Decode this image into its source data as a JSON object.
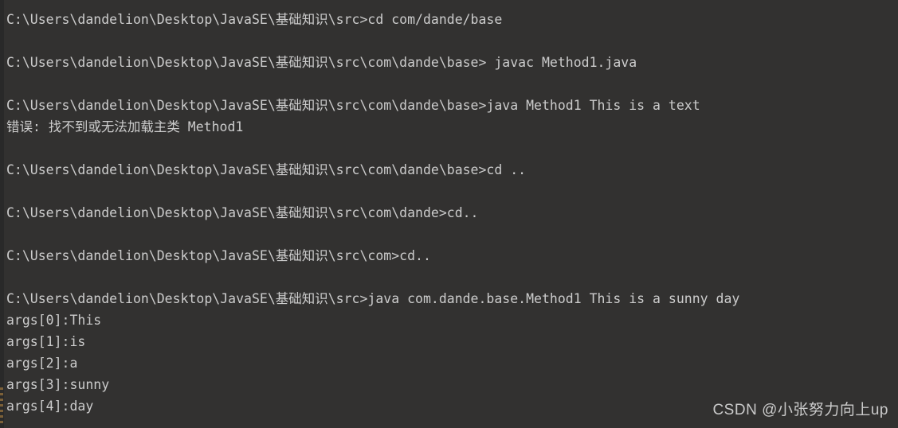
{
  "terminal": {
    "title": "Command Prompt",
    "background_color": "#323130",
    "text_color": "#cccccc",
    "gutter_color": "#292929",
    "lines": [
      {
        "id": "line-0",
        "text": "C:\\Users\\dandelion\\Desktop\\JavaSE\\基础知识\\src>cd com/dande/base"
      },
      {
        "id": "line-1",
        "text": ""
      },
      {
        "id": "line-2",
        "text": "C:\\Users\\dandelion\\Desktop\\JavaSE\\基础知识\\src\\com\\dande\\base> javac Method1.java"
      },
      {
        "id": "line-3",
        "text": ""
      },
      {
        "id": "line-4",
        "text": "C:\\Users\\dandelion\\Desktop\\JavaSE\\基础知识\\src\\com\\dande\\base>java Method1 This is a text"
      },
      {
        "id": "line-5",
        "text": "错误: 找不到或无法加载主类 Method1"
      },
      {
        "id": "line-6",
        "text": ""
      },
      {
        "id": "line-7",
        "text": "C:\\Users\\dandelion\\Desktop\\JavaSE\\基础知识\\src\\com\\dande\\base>cd .."
      },
      {
        "id": "line-8",
        "text": ""
      },
      {
        "id": "line-9",
        "text": "C:\\Users\\dandelion\\Desktop\\JavaSE\\基础知识\\src\\com\\dande>cd.."
      },
      {
        "id": "line-10",
        "text": ""
      },
      {
        "id": "line-11",
        "text": "C:\\Users\\dandelion\\Desktop\\JavaSE\\基础知识\\src\\com>cd.."
      },
      {
        "id": "line-12",
        "text": ""
      },
      {
        "id": "line-13",
        "text": "C:\\Users\\dandelion\\Desktop\\JavaSE\\基础知识\\src>java com.dande.base.Method1 This is a sunny day"
      },
      {
        "id": "line-14",
        "text": "args[0]:This"
      },
      {
        "id": "line-15",
        "text": "args[1]:is"
      },
      {
        "id": "line-16",
        "text": "args[2]:a"
      },
      {
        "id": "line-17",
        "text": "args[3]:sunny"
      },
      {
        "id": "line-18",
        "text": "args[4]:day"
      }
    ]
  },
  "watermark": {
    "text": "CSDN @小张努力向上up"
  }
}
